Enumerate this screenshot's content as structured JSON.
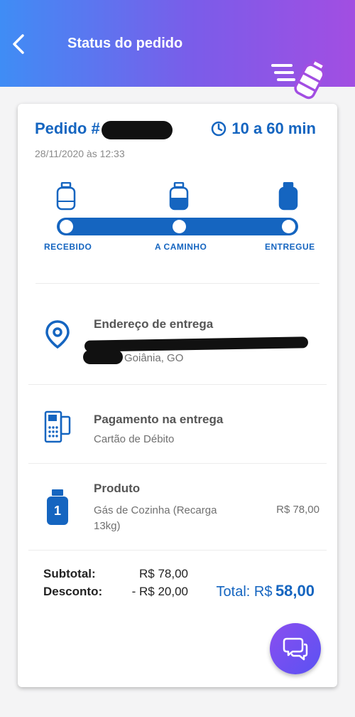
{
  "header": {
    "title": "Status do pedido",
    "back_icon": "chevron-left-icon",
    "gas_icon": "gas-cylinder-delivery-icon"
  },
  "order": {
    "title_prefix": "Pedido #",
    "eta": "10 a 60 min",
    "date": "28/11/2020 às 12:33"
  },
  "progress": {
    "steps": [
      "RECEBIDO",
      "A CAMINHO",
      "ENTREGUE"
    ],
    "completed_fraction": 1.0
  },
  "address": {
    "title": "Endereço de entrega",
    "city": "Goiânia, GO",
    "icon": "location-pin-icon"
  },
  "payment": {
    "title": "Pagamento na entrega",
    "method": "Cartão de Débito",
    "icon": "card-machine-icon"
  },
  "product": {
    "title": "Produto",
    "name_line1": "Gás de Cozinha (Recarga",
    "name_line2": "13kg)",
    "price": "R$ 78,00",
    "quantity": "1",
    "icon": "gas-cylinder-icon"
  },
  "summary": {
    "subtotal_label": "Subtotal:",
    "subtotal_value": "R$ 78,00",
    "discount_label": "Desconto:",
    "discount_value": "- R$ 20,00",
    "total_label": "Total: R$",
    "total_value": "58,00"
  },
  "colors": {
    "primary": "#1565c0",
    "header_gradient_start": "#3f8df5",
    "header_gradient_end": "#a24ee2"
  },
  "chat": {
    "icon": "chat-bubbles-icon"
  }
}
